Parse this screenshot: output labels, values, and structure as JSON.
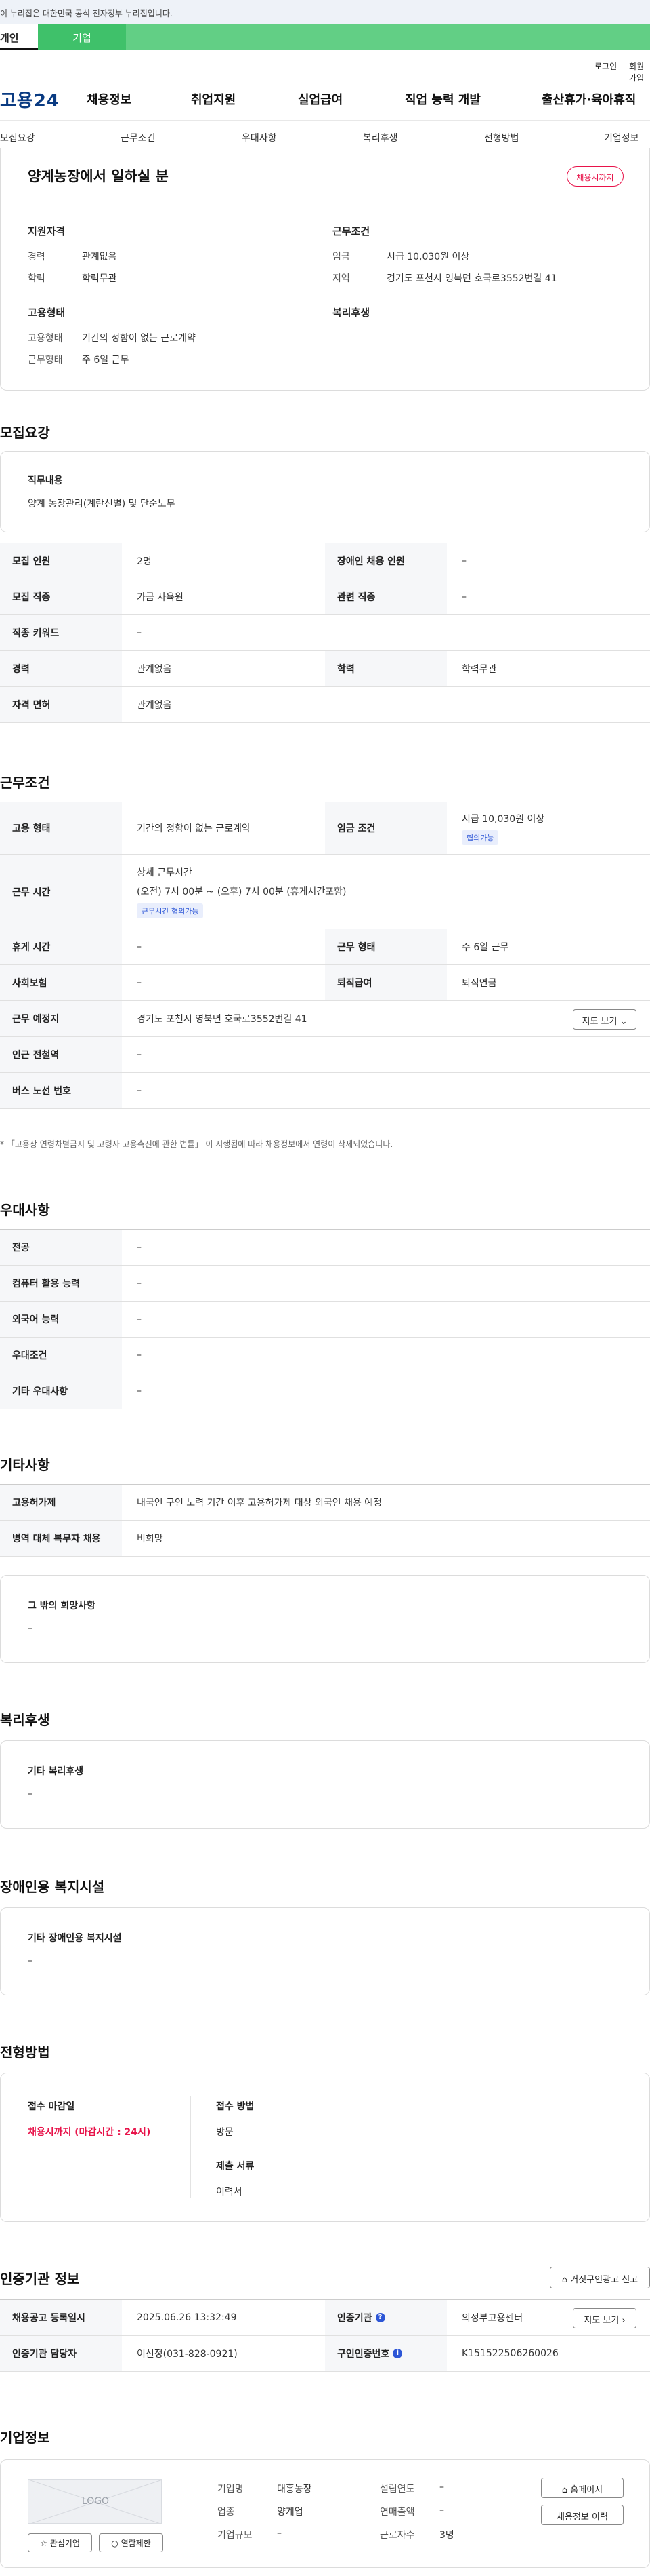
{
  "gov_banner": "이 누리집은 대한민국 공식 전자정부 누리집입니다.",
  "tabs": {
    "personal": "개인",
    "company": "기업"
  },
  "util": {
    "login": "로그인",
    "signup": "회원가입"
  },
  "gnb": {
    "logo": "고용24",
    "menus": [
      "채용정보",
      "취업지원",
      "실업급여",
      "직업 능력 개발",
      "출산휴가·육아휴직"
    ]
  },
  "snb": [
    "모집요강",
    "근무조건",
    "우대사항",
    "복리후생",
    "전형방법",
    "기업정보"
  ],
  "summary": {
    "title": "양계농장에서 일하실 분",
    "status_badge": "채용시까지",
    "qual_heading": "지원자격",
    "career_label": "경력",
    "career_value": "관계없음",
    "edu_label": "학력",
    "edu_value": "학력무관",
    "emp_heading": "고용형태",
    "emp_type_label": "고용형태",
    "emp_type_value": "기간의 정함이 없는 근로계약",
    "work_form_label": "근무형태",
    "work_form_value": "주 6일 근무",
    "cond_heading": "근무조건",
    "wage_label": "임금",
    "wage_value": "시급 10,030원 이상",
    "region_label": "지역",
    "region_value": "경기도 포천시 영북면 호국로3552번길 41",
    "welfare_heading": "복리후생"
  },
  "recruit": {
    "title": "모집요강",
    "duty_label": "직무내용",
    "duty_value": "양계 농장관리(계란선별) 및 단순노무",
    "rows": [
      {
        "th": "모집 인원",
        "td": "2명",
        "th2": "장애인 채용 인원",
        "td2": "–"
      },
      {
        "th": "모집 직종",
        "td": "가금 사육원",
        "th2": "관련 직종",
        "td2": "–"
      },
      {
        "th": "직종 키워드",
        "td": "–"
      },
      {
        "th": "경력",
        "td": "관계없음",
        "th2": "학력",
        "td2": "학력무관"
      },
      {
        "th": "자격 면허",
        "td": "관계없음"
      }
    ]
  },
  "work": {
    "title": "근무조건",
    "emp_type_th": "고용 형태",
    "emp_type_td": "기간의 정함이 없는 근로계약",
    "wage_th": "임금 조건",
    "wage_td": "시급 10,030원 이상",
    "wage_badge": "협의가능",
    "time_th": "근무 시간",
    "time_heading": "상세 근무시간",
    "time_value": "(오전) 7시 00분 ~ (오후) 7시 00분 (휴게시간포함)",
    "time_badge": "근무시간 협의가능",
    "rest_th": "휴게 시간",
    "rest_td": "–",
    "form_th": "근무 형태",
    "form_td": "주 6일 근무",
    "ins_th": "사회보험",
    "ins_td": "–",
    "retire_th": "퇴직급여",
    "retire_td": "퇴직연금",
    "place_th": "근무 예정지",
    "place_td": "경기도 포천시 영북면 호국로3552번길 41",
    "map_btn": "지도 보기",
    "station_th": "인근 전철역",
    "station_td": "–",
    "bus_th": "버스 노선 번호",
    "bus_td": "–",
    "note": "* 「고용상 연령차별금지 및 고령자 고용촉진에 관한 법률」 이 시행됨에 따라 채용정보에서 연령이 삭제되었습니다."
  },
  "pref": {
    "title": "우대사항",
    "rows": [
      {
        "th": "전공",
        "td": "–"
      },
      {
        "th": "컴퓨터 활용 능력",
        "td": "–"
      },
      {
        "th": "외국어 능력",
        "td": "–"
      },
      {
        "th": "우대조건",
        "td": "–"
      },
      {
        "th": "기타 우대사항",
        "td": "–"
      }
    ]
  },
  "etc": {
    "title": "기타사항",
    "rows": [
      {
        "th": "고용허가제",
        "td": "내국인 구인 노력 기간 이후 고용허가제 대상 외국인 채용 예정"
      },
      {
        "th": "병역 대체 복무자 채용",
        "td": "비희망"
      }
    ],
    "hope_label": "그 밖의 희망사항",
    "hope_value": "–"
  },
  "welfare": {
    "title": "복리후생",
    "label": "기타 복리후생",
    "value": "–"
  },
  "disabled": {
    "title": "장애인용 복지시설",
    "label": "기타 장애인용 복지시설",
    "value": "–"
  },
  "selection": {
    "title": "전형방법",
    "deadline_label": "접수 마감일",
    "deadline_value": "채용시까지 (마감시간 : 24시)",
    "method_label": "접수 방법",
    "method_value": "방문",
    "docs_label": "제출 서류",
    "docs_value": "이력서"
  },
  "cert": {
    "title": "인증기관 정보",
    "report_btn": "거짓구인광고 신고",
    "reg_th": "채용공고 등록일시",
    "reg_td": "2025.06.26 13:32:49",
    "agency_th": "인증기관",
    "agency_td": "의정부고용센터",
    "map_btn": "지도 보기",
    "manager_th": "인증기관 담당자",
    "manager_td": "이선정(031-828-0921)",
    "num_th": "구인인증번호",
    "num_td": "K151522506260026"
  },
  "company": {
    "title": "기업정보",
    "logo_text": "LOGO",
    "fav_btn": "관심기업",
    "view_btn": "열람제한",
    "name_label": "기업명",
    "name_value": "대흥농장",
    "industry_label": "업종",
    "industry_value": "양계업",
    "size_label": "기업규모",
    "size_value": "–",
    "founded_label": "설립연도",
    "founded_value": "–",
    "sales_label": "연매출액",
    "sales_value": "–",
    "staff_label": "근로자수",
    "staff_value": "3명",
    "home_btn": "홈페이지",
    "history_btn": "채용정보 이력"
  },
  "colors": {
    "brand_green": "#3fc16a",
    "accent_red": "#e8134a",
    "logo_blue": "#0a3b82"
  }
}
